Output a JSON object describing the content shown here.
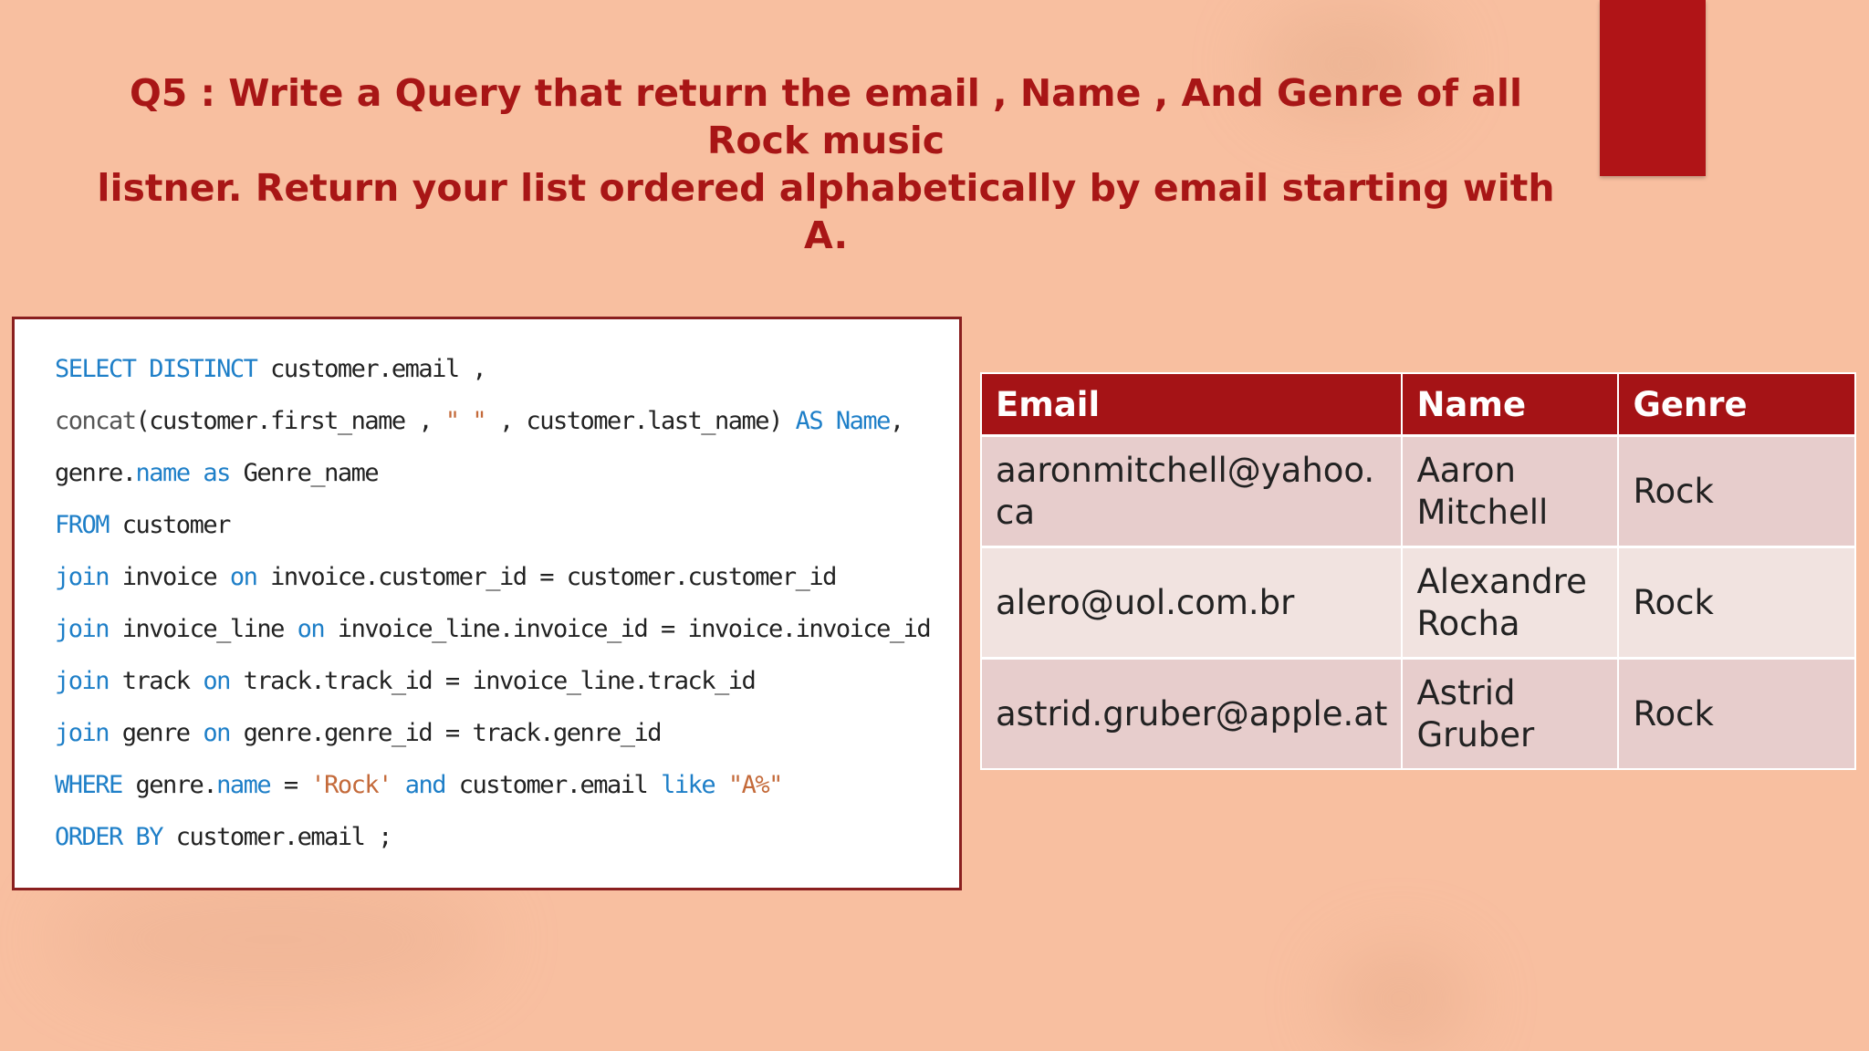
{
  "title": {
    "line1": "Q5 : Write a Query that return the email , Name , And Genre of all Rock music",
    "line2": "listner. Return your list ordered alphabetically by email starting with A."
  },
  "code": {
    "lines": [
      [
        {
          "t": "SELECT DISTINCT",
          "c": "kw"
        },
        {
          "t": " customer.email ,",
          "c": ""
        }
      ],
      [
        {
          "t": "concat",
          "c": "fn"
        },
        {
          "t": "(customer.first_name , ",
          "c": ""
        },
        {
          "t": "\" \"",
          "c": "str"
        },
        {
          "t": " , customer.last_name) ",
          "c": ""
        },
        {
          "t": "AS Name",
          "c": "kw"
        },
        {
          "t": ",",
          "c": ""
        }
      ],
      [
        {
          "t": "genre.",
          "c": ""
        },
        {
          "t": "name as",
          "c": "kw"
        },
        {
          "t": " Genre_name",
          "c": ""
        }
      ],
      [
        {
          "t": "FROM",
          "c": "kw"
        },
        {
          "t": " customer",
          "c": ""
        }
      ],
      [
        {
          "t": "join",
          "c": "kw"
        },
        {
          "t": " invoice ",
          "c": ""
        },
        {
          "t": "on",
          "c": "kw"
        },
        {
          "t": " invoice.customer_id = customer.customer_id",
          "c": ""
        }
      ],
      [
        {
          "t": "join",
          "c": "kw"
        },
        {
          "t": " invoice_line ",
          "c": ""
        },
        {
          "t": "on",
          "c": "kw"
        },
        {
          "t": " invoice_line.invoice_id = invoice.invoice_id",
          "c": ""
        }
      ],
      [
        {
          "t": "join",
          "c": "kw"
        },
        {
          "t": " track ",
          "c": ""
        },
        {
          "t": "on",
          "c": "kw"
        },
        {
          "t": " track.track_id = invoice_line.track_id",
          "c": ""
        }
      ],
      [
        {
          "t": "join",
          "c": "kw"
        },
        {
          "t": " genre ",
          "c": ""
        },
        {
          "t": "on",
          "c": "kw"
        },
        {
          "t": " genre.genre_id = track.genre_id",
          "c": ""
        }
      ],
      [
        {
          "t": "WHERE",
          "c": "kw"
        },
        {
          "t": " genre.",
          "c": ""
        },
        {
          "t": "name",
          "c": "kw"
        },
        {
          "t": " = ",
          "c": ""
        },
        {
          "t": "'Rock'",
          "c": "str"
        },
        {
          "t": " ",
          "c": ""
        },
        {
          "t": "and",
          "c": "kw"
        },
        {
          "t": " customer.email ",
          "c": ""
        },
        {
          "t": "like",
          "c": "kw"
        },
        {
          "t": " ",
          "c": ""
        },
        {
          "t": "\"A%\"",
          "c": "str"
        }
      ],
      [
        {
          "t": "ORDER BY",
          "c": "kw"
        },
        {
          "t": " customer.email ;",
          "c": ""
        }
      ]
    ]
  },
  "table": {
    "headers": [
      "Email",
      "Name",
      "Genre"
    ],
    "rows": [
      [
        "aaronmitchell@yahoo.\nca",
        "Aaron Mitchell",
        "Rock"
      ],
      [
        "alero@uol.com.br",
        "Alexandre\nRocha",
        "Rock"
      ],
      [
        "astrid.gruber@apple.at",
        "Astrid Gruber",
        "Rock"
      ]
    ]
  },
  "colors": {
    "background": "#f8bfa0",
    "accent": "#a81616",
    "header_bg": "#a51316",
    "keyword": "#1e7fc8",
    "string": "#c46a3a"
  }
}
